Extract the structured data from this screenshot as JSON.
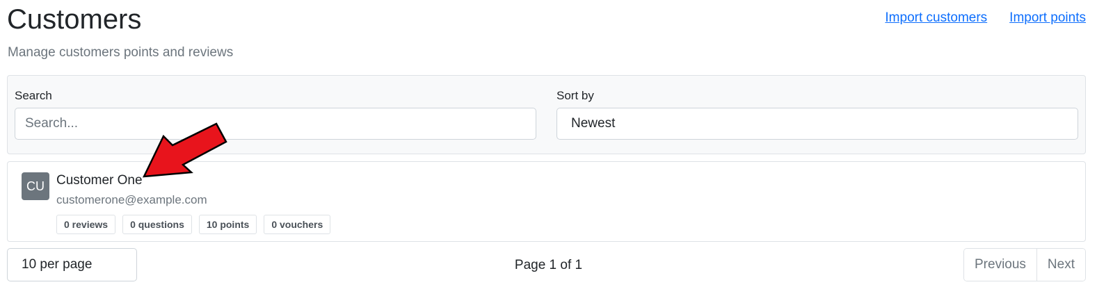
{
  "header": {
    "title": "Customers",
    "subtitle": "Manage customers points and reviews",
    "links": [
      {
        "label": "Import customers"
      },
      {
        "label": "Import points"
      }
    ]
  },
  "filters": {
    "search_label": "Search",
    "search_placeholder": "Search...",
    "search_value": "",
    "sort_label": "Sort by",
    "sort_value": "Newest"
  },
  "customers": [
    {
      "initials": "CU",
      "name": "Customer One",
      "email": "customerone@example.com",
      "badges": [
        "0 reviews",
        "0 questions",
        "10 points",
        "0 vouchers"
      ]
    }
  ],
  "annotation": {
    "arrow_color": "#e8141c",
    "arrow_icon": "red-pointer-arrow"
  },
  "pagination": {
    "per_page": "10 per page",
    "page_info": "Page 1 of 1",
    "previous_label": "Previous",
    "next_label": "Next"
  },
  "colors": {
    "link": "#0d6efd",
    "muted": "#6c757d",
    "panel_bg": "#f8f9fa",
    "avatar_bg": "#6c757d"
  }
}
